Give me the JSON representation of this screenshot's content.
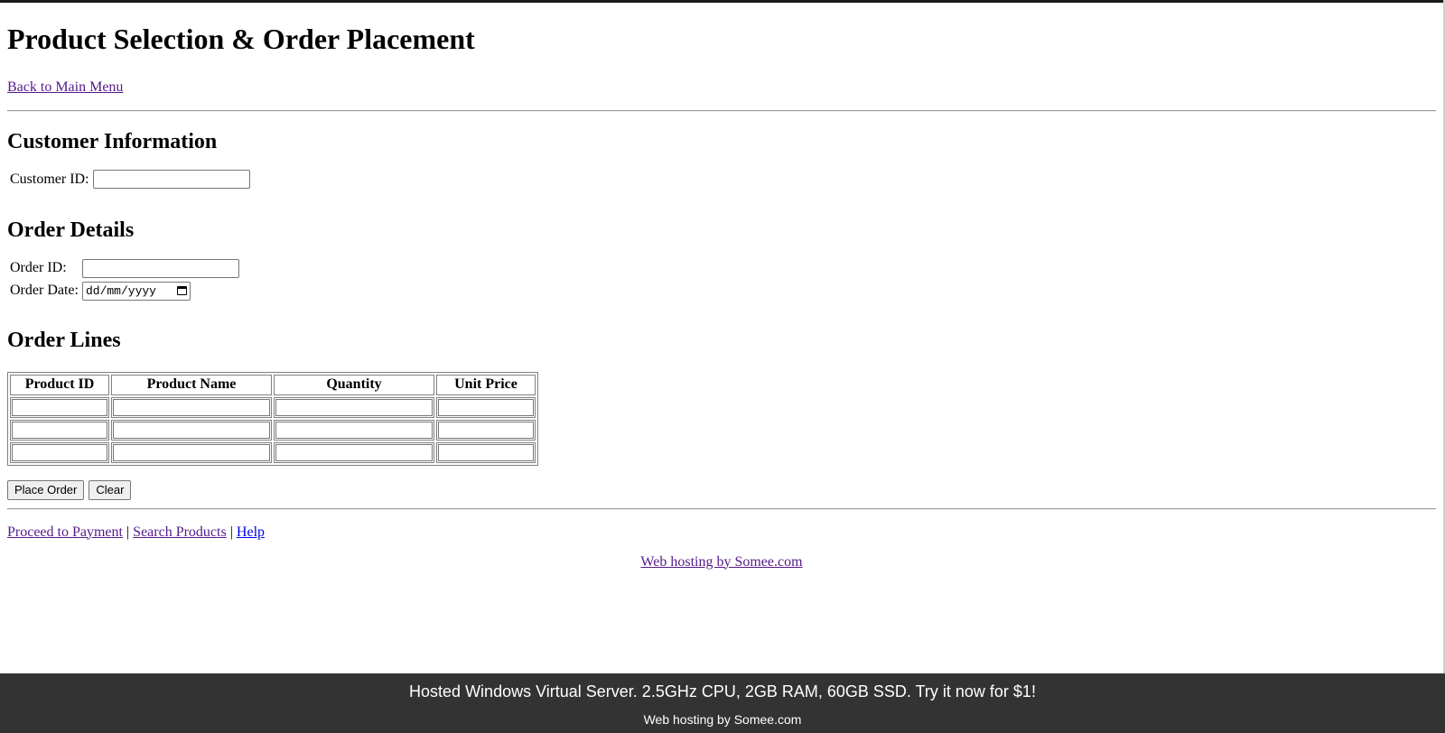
{
  "page": {
    "title": "Product Selection & Order Placement",
    "back_link": "Back to Main Menu"
  },
  "customer": {
    "heading": "Customer Information",
    "id_label": "Customer ID:",
    "id_value": ""
  },
  "order": {
    "heading": "Order Details",
    "id_label": "Order ID:",
    "id_value": "",
    "date_label": "Order Date:",
    "date_placeholder": "dd/mm/yyyy"
  },
  "order_lines": {
    "heading": "Order Lines",
    "columns": [
      "Product ID",
      "Product Name",
      "Quantity",
      "Unit Price"
    ],
    "rows": [
      [
        "",
        "",
        "",
        ""
      ],
      [
        "",
        "",
        "",
        ""
      ],
      [
        "",
        "",
        "",
        ""
      ]
    ]
  },
  "actions": {
    "place_order": "Place Order",
    "clear": "Clear"
  },
  "footer_links": {
    "payment": "Proceed to Payment",
    "search": "Search Products",
    "help": "Help",
    "separator": "|"
  },
  "hosting": {
    "link": "Web hosting by Somee.com"
  },
  "banner": {
    "headline": "Hosted Windows Virtual Server. 2.5GHz CPU, 2GB RAM, 60GB SSD. Try it now for $1!",
    "sub": "Web hosting by Somee.com",
    "background": "#333333"
  },
  "colors": {
    "visited_link": "#551a8b",
    "unvisited_link": "#0000ee"
  }
}
